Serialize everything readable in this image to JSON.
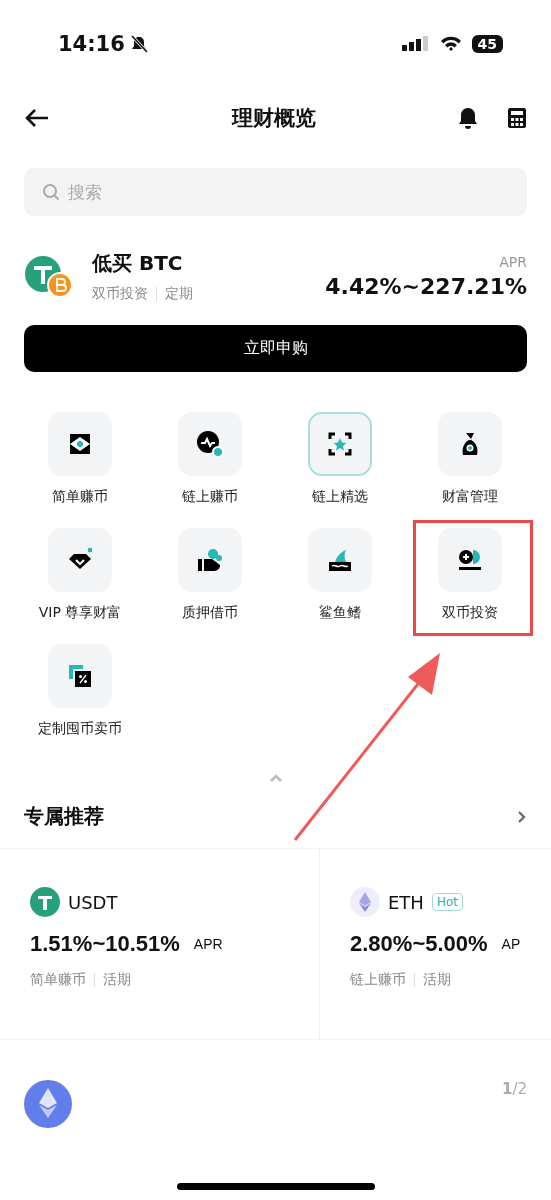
{
  "status_bar": {
    "time": "14:16",
    "battery": "45"
  },
  "header": {
    "title": "理财概览"
  },
  "search": {
    "placeholder": "搜索"
  },
  "featured": {
    "title": "低买 BTC",
    "tags": [
      "双币投资",
      "定期"
    ],
    "apr_label": "APR",
    "apr": "4.42%~227.21%",
    "button": "立即申购"
  },
  "products": [
    {
      "label": "简单赚币",
      "selected": false,
      "annotated": false
    },
    {
      "label": "链上赚币",
      "selected": false,
      "annotated": false
    },
    {
      "label": "链上精选",
      "selected": true,
      "annotated": false
    },
    {
      "label": "财富管理",
      "selected": false,
      "annotated": false
    },
    {
      "label": "VIP 尊享财富",
      "selected": false,
      "annotated": false
    },
    {
      "label": "质押借币",
      "selected": false,
      "annotated": false
    },
    {
      "label": "鲨鱼鳍",
      "selected": false,
      "annotated": false
    },
    {
      "label": "双币投资",
      "selected": false,
      "annotated": true
    },
    {
      "label": "定制囤币卖币",
      "selected": false,
      "annotated": false
    }
  ],
  "recommend": {
    "title": "专属推荐",
    "cards": [
      {
        "coin": "USDT",
        "apr": "1.51%~10.51%",
        "apr_label": "APR",
        "tags": [
          "简单赚币",
          "活期"
        ]
      },
      {
        "coin": "ETH",
        "badge": "Hot",
        "apr": "2.80%~5.00%",
        "apr_label": "AP",
        "tags": [
          "链上赚币",
          "活期"
        ]
      }
    ],
    "pager": "**1**/2"
  }
}
